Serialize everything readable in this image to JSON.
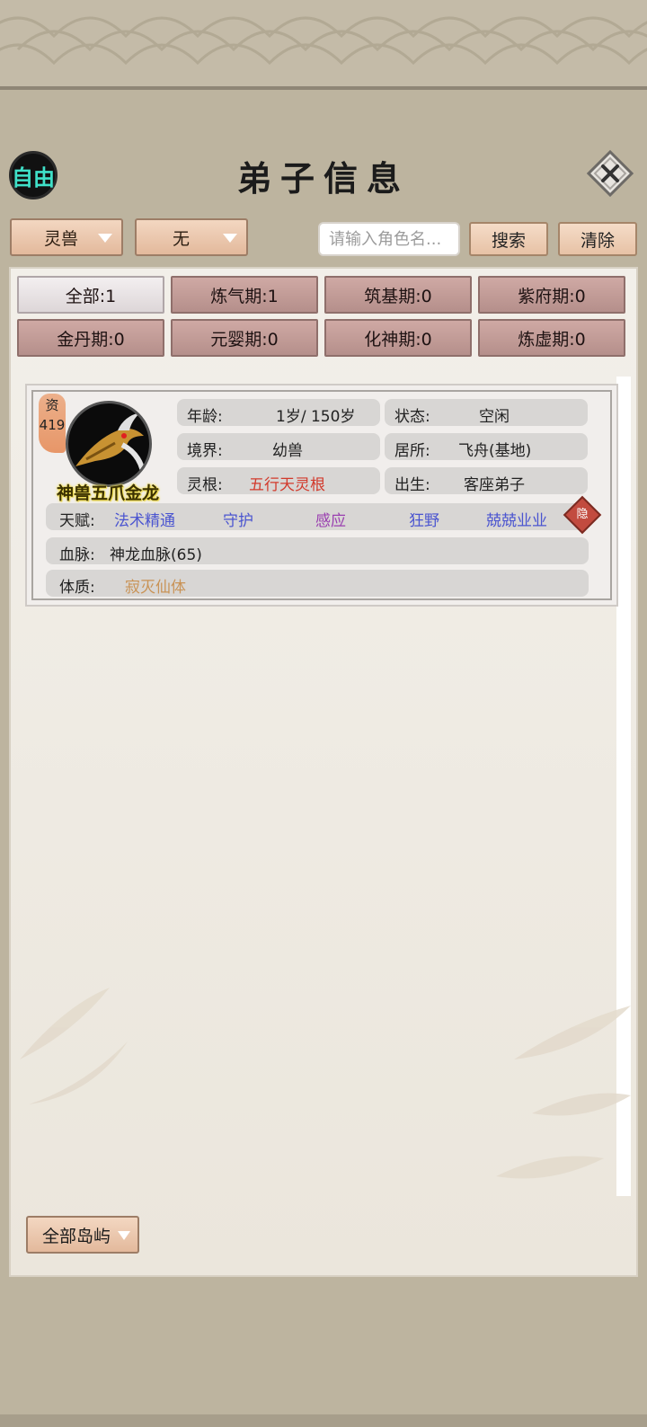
{
  "header": {
    "mode_badge": "自由",
    "title": "弟子信息",
    "close_icon": "close-x-icon"
  },
  "toolbar": {
    "type_filter": "灵兽",
    "second_filter": "无",
    "search_placeholder": "请输入角色名...",
    "search_value": "",
    "search_label": "搜索",
    "clear_label": "清除"
  },
  "tabs": [
    {
      "label": "全部:1",
      "active": true
    },
    {
      "label": "炼气期:1"
    },
    {
      "label": "筑基期:0"
    },
    {
      "label": "紫府期:0"
    },
    {
      "label": "金丹期:0"
    },
    {
      "label": "元婴期:0"
    },
    {
      "label": "化神期:0"
    },
    {
      "label": "炼虚期:0"
    }
  ],
  "disciple": {
    "aptitude_label": "资",
    "aptitude_value": "419",
    "name": "神兽五爪金龙",
    "age_label": "年龄:",
    "age_value": "1岁/ 150岁",
    "status_label": "状态:",
    "status_value": "空闲",
    "realm_label": "境界:",
    "realm_value": "幼兽",
    "residence_label": "居所:",
    "residence_value": "飞舟(基地)",
    "root_label": "灵根:",
    "root_value": "五行天灵根",
    "origin_label": "出生:",
    "origin_value": "客座弟子",
    "talent_label": "天赋:",
    "talents": [
      "法术精通",
      "守护",
      "感应",
      "狂野",
      "兢兢业业"
    ],
    "hide_label": "隐",
    "bloodline_label": "血脉:",
    "bloodline_value": "神龙血脉(65)",
    "physique_label": "体质:",
    "physique_value": "寂灭仙体"
  },
  "footer": {
    "island_filter": "全部岛屿"
  },
  "colors": {
    "root_value": "#d23a2c",
    "talent_blue": "#4b55d0",
    "talent_purple": "#9a3fb0",
    "physique": "#c99356",
    "free_badge": "#3fe0c8"
  }
}
